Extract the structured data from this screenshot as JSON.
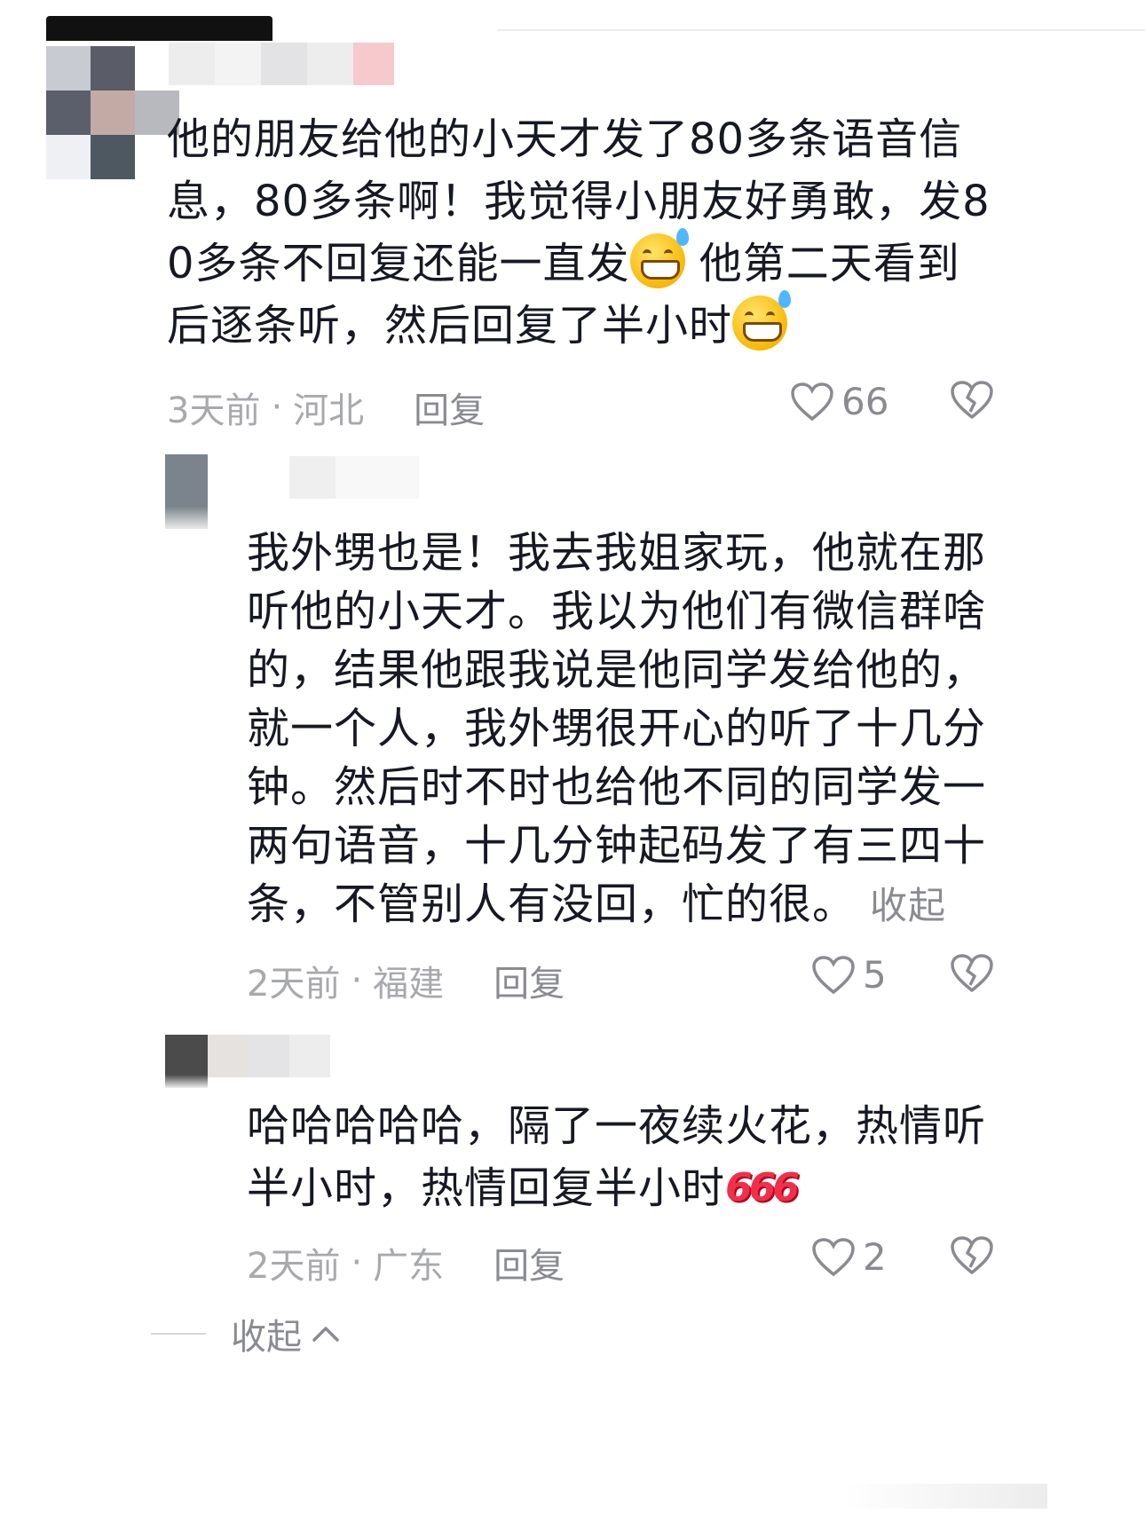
{
  "comments": [
    {
      "text": "他的朋友给他的小天才发了80多条语音信息，80多条啊！我觉得小朋友好勇敢，发80多条不回复还能一直发",
      "text_after_emoji": " 他第二天看到后逐条听，然后回复了半小时",
      "time": "3天前",
      "region": "河北",
      "reply_label": "回复",
      "likes": "66"
    },
    {
      "text": "我外甥也是！我去我姐家玩，他就在那听他的小天才。我以为他们有微信群啥的，结果他跟我说是他同学发给他的，就一个人，我外甥很开心的听了十几分钟。然后时不时也给他不同的同学发一两句语音，十几分钟起码发了有三四十条，不管别人有没回，忙的很。",
      "collapse_label": "收起",
      "time": "2天前",
      "region": "福建",
      "reply_label": "回复",
      "likes": "5"
    },
    {
      "text": "哈哈哈哈哈，隔了一夜续火花，热情听半小时，热情回复半小时",
      "sticker": "666",
      "time": "2天前",
      "region": "广东",
      "reply_label": "回复",
      "likes": "2"
    }
  ],
  "footer": {
    "collapse_label": "收起"
  },
  "icons": {
    "like": "heart-outline-icon",
    "dislike": "broken-heart-icon",
    "emoji": "grinning-sweat-emoji",
    "chevron": "chevron-up-icon"
  },
  "colors": {
    "text": "#161823",
    "meta": "#a8a9ad",
    "action": "#8a8b91",
    "sticker": "#f0304a"
  }
}
